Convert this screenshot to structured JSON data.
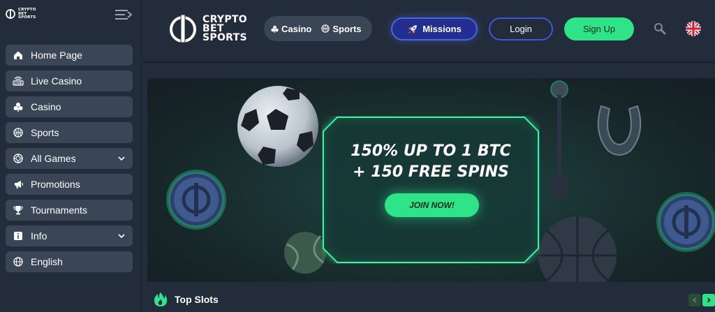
{
  "sidebar": {
    "logo_lines": [
      "CRYPTO",
      "BET",
      "SPORTS"
    ],
    "items": [
      {
        "label": "Home Page",
        "icon": "home-icon"
      },
      {
        "label": "Live Casino",
        "icon": "live-casino-icon"
      },
      {
        "label": "Casino",
        "icon": "clubs-icon"
      },
      {
        "label": "Sports",
        "icon": "basketball-icon"
      },
      {
        "label": "All Games",
        "icon": "chip-icon"
      },
      {
        "label": "Promotions",
        "icon": "megaphone-icon"
      },
      {
        "label": "Tournaments",
        "icon": "trophy-icon"
      },
      {
        "label": "Info",
        "icon": "info-icon"
      },
      {
        "label": "English",
        "icon": "globe-icon"
      }
    ]
  },
  "header": {
    "logo_lines": [
      "CRYPTO",
      "BET",
      "SPORTS"
    ],
    "categories": [
      {
        "label": "Casino",
        "icon": "clubs-icon"
      },
      {
        "label": "Sports",
        "icon": "basketball-icon"
      }
    ],
    "missions_label": "Missions",
    "login_label": "Login",
    "signup_label": "Sign Up"
  },
  "banner": {
    "title_line1": "150% UP TO 1 BTC",
    "title_line2": "+ 150 FREE SPINS",
    "cta_label": "JOIN NOW!"
  },
  "sections": {
    "top_slots_title": "Top Slots"
  },
  "colors": {
    "accent_green": "#2fe389",
    "accent_blue": "#3f57d8",
    "bg": "#232c3a",
    "nav_item": "#3a4556"
  }
}
